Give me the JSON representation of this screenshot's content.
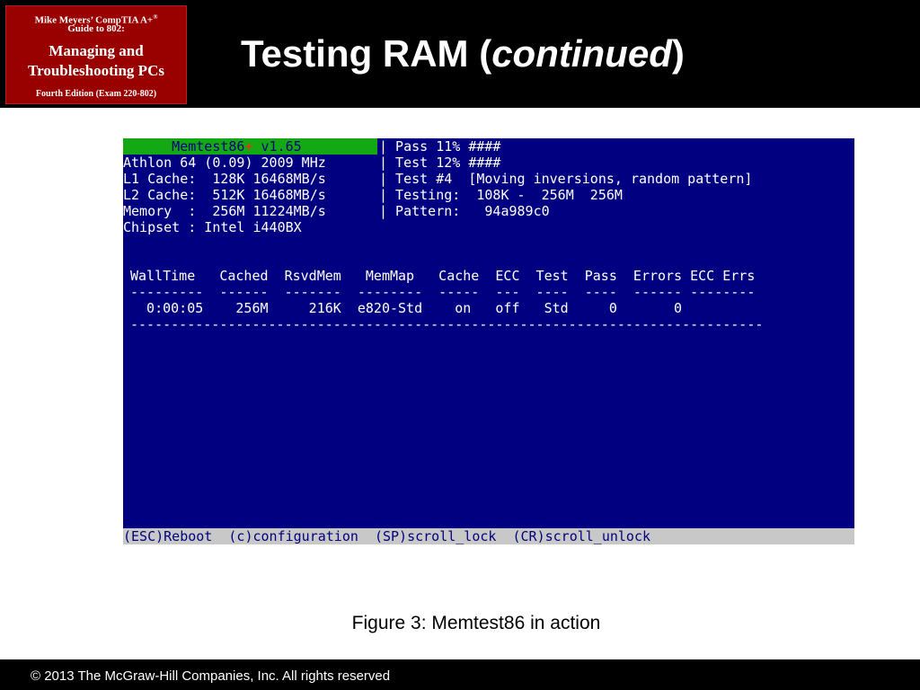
{
  "book": {
    "line1": "Mike Meyers’ CompTIA A+",
    "registered": "®",
    "line2": "Guide to 802:",
    "title1": "Managing and",
    "title2": "Troubleshooting PCs",
    "edition": "Fourth Edition (Exam 220-802)"
  },
  "slide": {
    "title_main": "Testing RAM (",
    "title_italic": "continued",
    "title_close": ")"
  },
  "memtest": {
    "banner_name": "      Memtest86",
    "banner_plus": "+",
    "banner_version": " v1.65",
    "left_lines": [
      "Athlon 64 (0.09) 2009 MHz",
      "L1 Cache:  128K 16468MB/s",
      "L2 Cache:  512K 16468MB/s",
      "Memory  :  256M 11224MB/s",
      "Chipset : Intel i440BX"
    ],
    "right_lines": [
      "| Pass 11% ####",
      "| Test 12% ####",
      "| Test #4  [Moving inversions, random pattern]",
      "| Testing:  108K -  256M  256M",
      "| Pattern:   94a989c0"
    ],
    "table_header": "WallTime   Cached  RsvdMem   MemMap   Cache  ECC  Test  Pass  Errors ECC Errs",
    "table_underline": "---------  ------  -------  --------  -----  ---  ----  ----  ------ --------",
    "table_row": "  0:00:05    256M     216K  e820-Std    on   off   Std     0       0",
    "table_rule": "------------------------------------------------------------------------------",
    "footer": "(ESC)Reboot  (c)configuration  (SP)scroll_lock  (CR)scroll_unlock"
  },
  "caption": "Figure 3: Memtest86 in action",
  "copyright": "© 2013 The McGraw-Hill Companies, Inc. All rights reserved",
  "colors": {
    "header_bg": "#000000",
    "badge_bg": "#990000",
    "screen_bg": "#000080",
    "banner_bg": "#15a815",
    "footer_bar_bg": "#c8c8c8"
  }
}
